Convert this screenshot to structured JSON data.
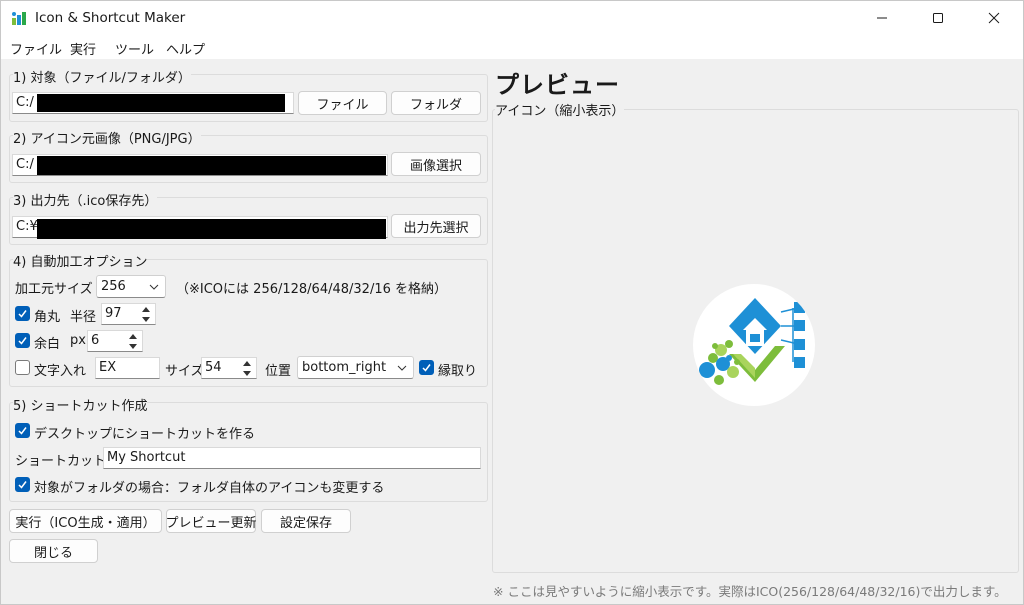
{
  "window": {
    "title": "Icon & Shortcut Maker"
  },
  "menu": {
    "items": [
      "ファイル",
      "実行",
      "ツール",
      "ヘルプ"
    ]
  },
  "target": {
    "legend": "1) 対象（ファイル/フォルダ）",
    "path_prefix": "C:/",
    "file_button": "ファイル",
    "folder_button": "フォルダ"
  },
  "image_source": {
    "legend": "2) アイコン元画像（PNG/JPG）",
    "path_prefix": "C:/",
    "select_button": "画像選択"
  },
  "output": {
    "legend": "3) 出力先（.ico保存先）",
    "path_prefix": "C:¥",
    "select_button": "出力先選択"
  },
  "options": {
    "legend": "4) 自動加工オプション",
    "size_label": "加工元サイズ",
    "size_value": "256",
    "size_note": "（※ICOには 256/128/64/48/32/16 を格納）",
    "round_label": "角丸",
    "round_checked": true,
    "radius_label": "半径",
    "radius_value": "97",
    "margin_label": "余白",
    "margin_checked": true,
    "px_label": "px",
    "margin_value": "6",
    "text_label": "文字入れ",
    "text_checked": false,
    "text_value": "EX",
    "font_size_label": "サイズ",
    "font_size_value": "54",
    "position_label": "位置",
    "position_value": "bottom_right",
    "outline_label": "縁取り",
    "outline_checked": true
  },
  "shortcut": {
    "legend": "5) ショートカット作成",
    "desktop_label": "デスクトップにショートカットを作る",
    "desktop_checked": true,
    "name_label": "ショートカット名",
    "name_value": "My Shortcut",
    "folder_icon_label": "対象がフォルダの場合：フォルダ自体のアイコンも変更する",
    "folder_icon_checked": true
  },
  "actions": {
    "run": "実行（ICO生成・適用）",
    "refresh": "プレビュー更新",
    "save": "設定保存",
    "close": "閉じる"
  },
  "preview": {
    "title": "プレビュー",
    "subtitle": "アイコン（縮小表示）",
    "note": "※ ここは見やすいように縮小表示です。実際はICO(256/128/64/48/32/16)で出力します。"
  },
  "colors": {
    "accent": "#005fb8",
    "icon_blue": "#1e90d6",
    "icon_green": "#7dbd3b",
    "icon_green_light": "#a9d45c"
  }
}
